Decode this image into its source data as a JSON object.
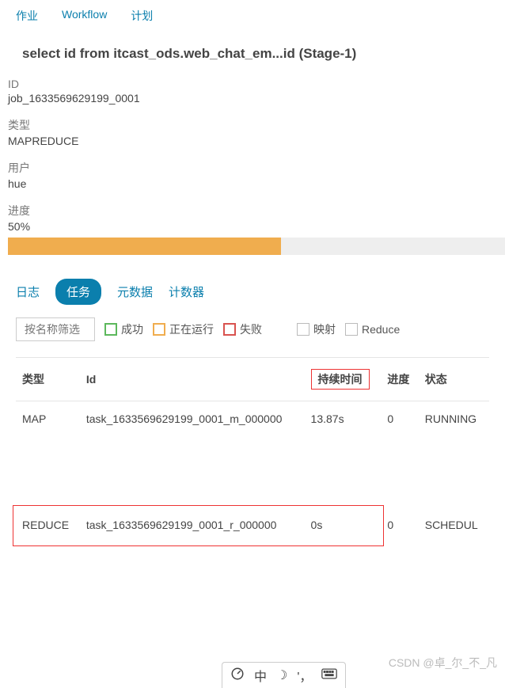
{
  "nav": {
    "jobs": "作业",
    "workflow": "Workflow",
    "plan": "计划"
  },
  "title": "select id from itcast_ods.web_chat_em...id (Stage-1)",
  "fields": {
    "id_label": "ID",
    "id_value": "job_1633569629199_0001",
    "type_label": "类型",
    "type_value": "MAPREDUCE",
    "user_label": "用户",
    "user_value": "hue",
    "progress_label": "进度",
    "progress_value": "50%"
  },
  "progress_pct": 55,
  "subtabs": {
    "log": "日志",
    "tasks": "任务",
    "metadata": "元数据",
    "counters": "计数器"
  },
  "filters": {
    "placeholder": "按名称筛选",
    "success": "成功",
    "running": "正在运行",
    "failed": "失败",
    "map": "映射",
    "reduce": "Reduce"
  },
  "colors": {
    "success": "#5cb85c",
    "running": "#f0ad4e",
    "failed": "#d9534f"
  },
  "table": {
    "headers": {
      "type": "类型",
      "id": "Id",
      "duration": "持续时间",
      "progress": "进度",
      "status": "状态"
    },
    "rows": [
      {
        "type": "MAP",
        "id": "task_1633569629199_0001_m_000000",
        "duration": "13.87s",
        "progress": "0",
        "status": "RUNNING"
      },
      {
        "type": "REDUCE",
        "id": "task_1633569629199_0001_r_000000",
        "duration": "0s",
        "progress": "0",
        "status": "SCHEDUL"
      }
    ]
  },
  "toolbar": {
    "ime": "中",
    "moon": "☽",
    "comma": "'，",
    "gauge": "◔"
  },
  "watermark": "CSDN @卓_尔_不_凡"
}
